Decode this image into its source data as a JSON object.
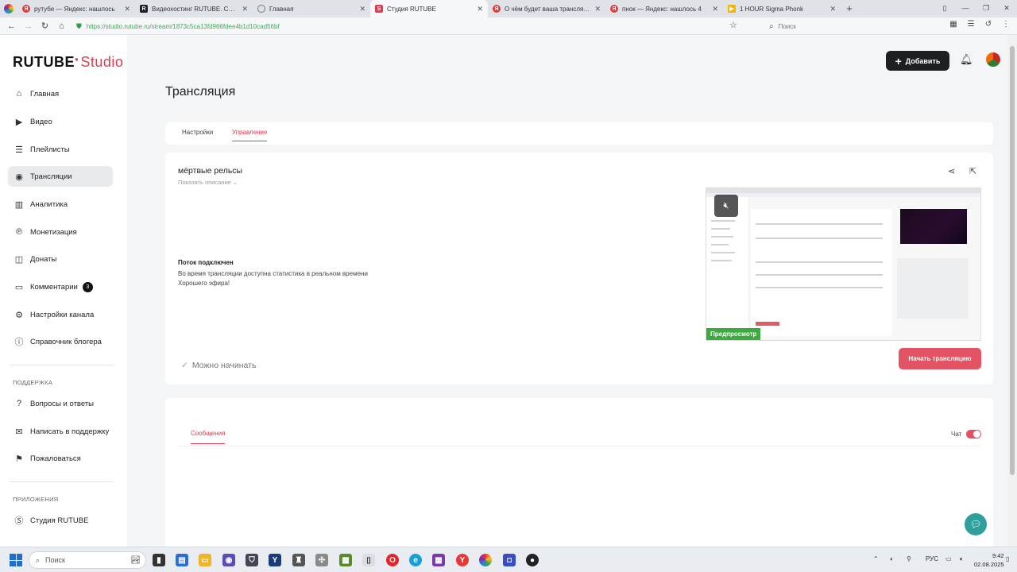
{
  "browser": {
    "tabs": [
      {
        "title": "рутубе — Яндекс: нашлось",
        "favicon": "yandex-icon",
        "color": "#e53935"
      },
      {
        "title": "Видеохостинг RUTUBE. Смотр",
        "favicon": "rutube-icon",
        "color": "#1d1f22"
      },
      {
        "title": "Главная",
        "favicon": "globe-icon",
        "color": "#777777"
      },
      {
        "title": "Студия RUTUBE",
        "favicon": "rutube-studio-icon",
        "color": "#e23a4e"
      },
      {
        "title": "О чём будет ваша трансляция",
        "favicon": "yandex-icon",
        "color": "#e53935"
      },
      {
        "title": "пнок — Яндекс: нашлось 4",
        "favicon": "yandex-icon",
        "color": "#e53935"
      },
      {
        "title": "1 HOUR Sigma Phonk",
        "favicon": "youtube-icon",
        "color": "#f4b400"
      }
    ],
    "url": "https://studio.rutube.ru/stream/1873c5ca13fd966fdee4b1d10cad56bf",
    "search_placeholder": "Поиск"
  },
  "logo": {
    "brand": "RUTUBE",
    "product": "Studio"
  },
  "sidebar": {
    "items": [
      {
        "label": "Главная",
        "icon": "home-icon"
      },
      {
        "label": "Видео",
        "icon": "video-icon"
      },
      {
        "label": "Плейлисты",
        "icon": "playlist-icon"
      },
      {
        "label": "Трансляции",
        "icon": "broadcast-icon",
        "active": true
      },
      {
        "label": "Аналитика",
        "icon": "analytics-icon"
      },
      {
        "label": "Монетизация",
        "icon": "monetization-icon"
      },
      {
        "label": "Донаты",
        "icon": "donate-icon"
      },
      {
        "label": "Комментарии",
        "icon": "comments-icon",
        "badge": "3"
      },
      {
        "label": "Настройки канала",
        "icon": "settings-icon"
      },
      {
        "label": "Справочник блогера",
        "icon": "info-icon"
      }
    ],
    "support_heading": "ПОДДЕРЖКА",
    "support_items": [
      {
        "label": "Вопросы и ответы",
        "icon": "question-icon"
      },
      {
        "label": "Написать в поддержку",
        "icon": "mail-icon"
      },
      {
        "label": "Пожаловаться",
        "icon": "flag-icon"
      }
    ],
    "apps_heading": "ПРИЛОЖЕНИЯ",
    "apps_items": [
      {
        "label": "Студия RUTUBE",
        "icon": "studio-app-icon"
      }
    ]
  },
  "header": {
    "add_label": "Добавить"
  },
  "main": {
    "title": "Трансляция",
    "tabs": [
      "Настройки",
      "Управление"
    ],
    "active_tab": "Управление",
    "stream": {
      "name": "мёртвые рельсы",
      "show_description": "Показать описание",
      "status_title": "Поток подключен",
      "status_line1": "Во время трансляции доступна статистика в реальном времени",
      "status_line2": "Хорошего эфира!",
      "ready_text": "Можно начинать",
      "preview_label": "Предпросмотр",
      "start_button": "Начать трансляцию"
    },
    "chat": {
      "messages_tab": "Сообщения",
      "chat_label": "Чат",
      "chat_enabled": true
    }
  },
  "taskbar": {
    "search_placeholder": "Поиск",
    "lang": "РУС",
    "time": "9:42",
    "date": "02.08.2025"
  },
  "colors": {
    "accent": "#e23a4e",
    "start_button": "#e25463",
    "preview_badge": "#3caa3c",
    "help": "#2f9f9c"
  }
}
